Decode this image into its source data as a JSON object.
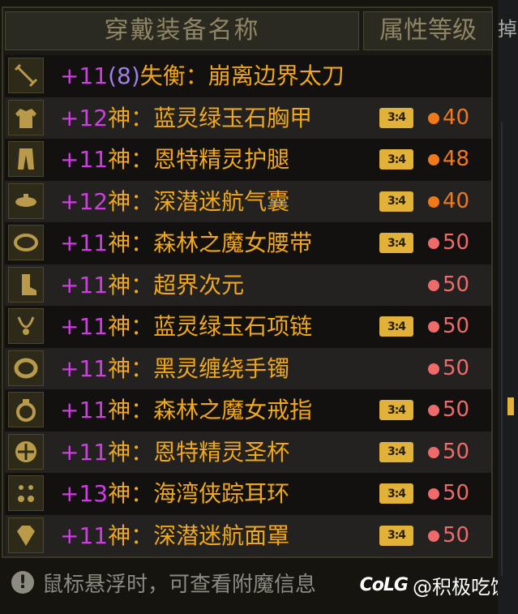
{
  "header": {
    "name_col": "穿戴装备名称",
    "grade_col": "属性等级"
  },
  "items": [
    {
      "slot": "sword-icon",
      "plus": "+11",
      "paren": "(8)",
      "name": "失衡：崩离边界太刀",
      "badge": "",
      "dot_color": "",
      "level": ""
    },
    {
      "slot": "coat-icon",
      "plus": "+12",
      "paren": "",
      "name": "神：蓝灵绿玉石胸甲",
      "badge": "3:4",
      "dot_color": "#f07a1a",
      "level": "40",
      "level_color": "#f07a1a"
    },
    {
      "slot": "pants-icon",
      "plus": "+11",
      "paren": "",
      "name": "神：恩特精灵护腿",
      "badge": "3:4",
      "dot_color": "#f07a1a",
      "level": "48",
      "level_color": "#f07a1a"
    },
    {
      "slot": "shoulder-icon",
      "plus": "+12",
      "paren": "",
      "name": "神：深潜迷航气囊",
      "badge": "3:4",
      "dot_color": "#f07a1a",
      "level": "40",
      "level_color": "#f07a1a"
    },
    {
      "slot": "belt-icon",
      "plus": "+11",
      "paren": "",
      "name": "神：森林之魔女腰带",
      "badge": "3:4",
      "dot_color": "#ef6a6a",
      "level": "50",
      "level_color": "#ef6a6a"
    },
    {
      "slot": "boots-icon",
      "plus": "+11",
      "paren": "",
      "name": "神：超界次元",
      "badge": "",
      "dot_color": "#ef6a6a",
      "level": "50",
      "level_color": "#ef6a6a"
    },
    {
      "slot": "necklace-icon",
      "plus": "+11",
      "paren": "",
      "name": "神：蓝灵绿玉石项链",
      "badge": "3:4",
      "dot_color": "#ef6a6a",
      "level": "50",
      "level_color": "#ef6a6a"
    },
    {
      "slot": "bracelet-icon",
      "plus": "+11",
      "paren": "",
      "name": "神：黑灵缠绕手镯",
      "badge": "",
      "dot_color": "#ef6a6a",
      "level": "50",
      "level_color": "#ef6a6a"
    },
    {
      "slot": "ring-icon",
      "plus": "+11",
      "paren": "",
      "name": "神：森林之魔女戒指",
      "badge": "3:4",
      "dot_color": "#ef6a6a",
      "level": "50",
      "level_color": "#ef6a6a"
    },
    {
      "slot": "subequip-icon",
      "plus": "+11",
      "paren": "",
      "name": "神：恩特精灵圣杯",
      "badge": "3:4",
      "dot_color": "#ef6a6a",
      "level": "50",
      "level_color": "#ef6a6a"
    },
    {
      "slot": "earring-icon",
      "plus": "+13",
      "paren": "",
      "name": "神：海湾侠踪耳环",
      "badge": "3:4",
      "dot_color": "#ef6a6a",
      "level": "50",
      "level_color": "#ef6a6a"
    },
    {
      "slot": "magicstone-icon",
      "plus": "+11",
      "paren": "",
      "name": "神：深潜迷航面罩",
      "badge": "3:4",
      "dot_color": "#ef6a6a",
      "level": "50",
      "level_color": "#ef6a6a"
    }
  ],
  "footer": {
    "hint": "鼠标悬浮时，可查看附魔信息",
    "info_icon": "exclamation-icon"
  },
  "watermark": {
    "logo": "CoLG",
    "text": "@积极吃饭"
  },
  "colors": {
    "plus": "#d23be6",
    "name": "#f0a818",
    "badge": "#e2b238"
  }
}
